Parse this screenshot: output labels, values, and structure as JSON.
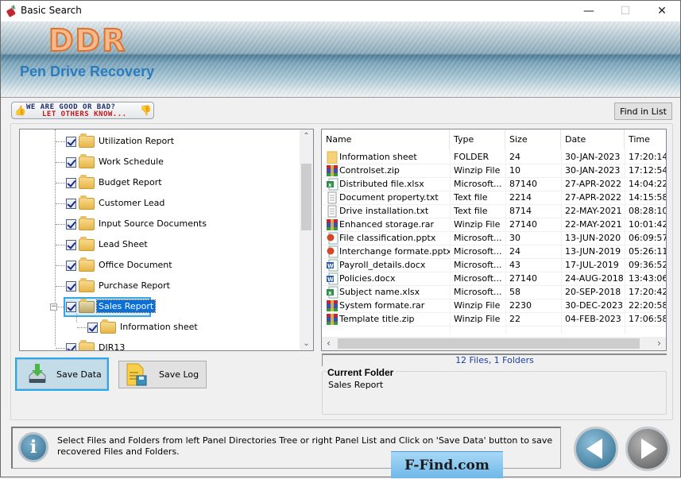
{
  "window": {
    "title": "Basic Search",
    "controls": {
      "minimize": "—",
      "maximize": "☐",
      "close": "✕"
    }
  },
  "banner": {
    "logo": "DDR",
    "product": "Pen Drive Recovery"
  },
  "feedback": {
    "line1": "WE ARE GOOD OR BAD?",
    "line2": "LET OTHERS KNOW...",
    "icon_up": "thumbs-up-icon",
    "icon_down": "thumbs-down-icon"
  },
  "toolbar": {
    "find_in_list": "Find in List"
  },
  "tree": {
    "items": [
      {
        "label": "Utilization Report",
        "checked": true,
        "level": 1
      },
      {
        "label": "Work Schedule",
        "checked": true,
        "level": 1
      },
      {
        "label": "Budget Report",
        "checked": true,
        "level": 1
      },
      {
        "label": "Customer Lead",
        "checked": true,
        "level": 1
      },
      {
        "label": "Input Source Documents",
        "checked": true,
        "level": 1
      },
      {
        "label": "Lead Sheet",
        "checked": true,
        "level": 1
      },
      {
        "label": "Office Document",
        "checked": true,
        "level": 1
      },
      {
        "label": "Purchase Report",
        "checked": true,
        "level": 1
      },
      {
        "label": "Sales Report",
        "checked": true,
        "level": 1,
        "selected": true,
        "expanded": true
      },
      {
        "label": "Information sheet",
        "checked": true,
        "level": 2
      },
      {
        "label": "DIR13",
        "checked": true,
        "level": 1
      }
    ]
  },
  "file_list": {
    "columns": [
      "Name",
      "Type",
      "Size",
      "Date",
      "Time"
    ],
    "rows": [
      {
        "icon": "folder",
        "name": "Information sheet",
        "type": "FOLDER",
        "size": "24",
        "date": "30-JAN-2023",
        "time": "17:20:14"
      },
      {
        "icon": "archive",
        "name": "Controlset.zip",
        "type": "Winzip File",
        "size": "10",
        "date": "30-JAN-2023",
        "time": "17:12:54"
      },
      {
        "icon": "excel",
        "name": "Distributed file.xlsx",
        "type": "Microsoft...",
        "size": "87140",
        "date": "27-APR-2022",
        "time": "14:04:22"
      },
      {
        "icon": "text",
        "name": "Document property.txt",
        "type": "Text file",
        "size": "2214",
        "date": "27-APR-2022",
        "time": "14:15:58"
      },
      {
        "icon": "text",
        "name": "Drive installation.txt",
        "type": "Text file",
        "size": "8714",
        "date": "22-MAY-2021",
        "time": "08:28:10"
      },
      {
        "icon": "archive",
        "name": "Enhanced storage.rar",
        "type": "Winzip File",
        "size": "27140",
        "date": "22-MAY-2021",
        "time": "10:01:42"
      },
      {
        "icon": "powerpoint",
        "name": "File classification.pptx",
        "type": "Microsoft...",
        "size": "30",
        "date": "13-JUN-2020",
        "time": "06:09:57"
      },
      {
        "icon": "powerpoint",
        "name": "Interchange formate.pptx",
        "type": "Microsoft...",
        "size": "24",
        "date": "13-JUN-2019",
        "time": "05:26:11"
      },
      {
        "icon": "word",
        "name": "Payroll_details.docx",
        "type": "Microsoft...",
        "size": "43",
        "date": "17-JUL-2019",
        "time": "09:36:52"
      },
      {
        "icon": "word",
        "name": "Policies.docx",
        "type": "Microsoft...",
        "size": "27140",
        "date": "24-AUG-2018",
        "time": "13:43:06"
      },
      {
        "icon": "excel",
        "name": "Subject name.xlsx",
        "type": "Microsoft...",
        "size": "58",
        "date": "20-SEP-2018",
        "time": "17:20:42"
      },
      {
        "icon": "archive",
        "name": "System formate.rar",
        "type": "Winzip File",
        "size": "2230",
        "date": "30-DEC-2023",
        "time": "22:20:58"
      },
      {
        "icon": "archive",
        "name": "Template title.zip",
        "type": "Winzip File",
        "size": "22",
        "date": "04-FEB-2023",
        "time": "17:06:58"
      }
    ],
    "summary": "12 Files, 1 Folders"
  },
  "current_folder": {
    "label": "Current Folder",
    "value": "Sales Report"
  },
  "actions": {
    "save_data": "Save Data",
    "save_log": "Save Log"
  },
  "info": {
    "message": "Select Files and Folders from left Panel Directories Tree or right Panel List and Click on 'Save Data' button to save recovered Files and Folders."
  },
  "watermark": "F-Find.com",
  "colors": {
    "accent": "#2aa8ea",
    "selection": "#0a6fd8",
    "summary_text": "#1c3ea0",
    "logo_orange": "#e0732c",
    "product_blue": "#2a7bbd"
  }
}
